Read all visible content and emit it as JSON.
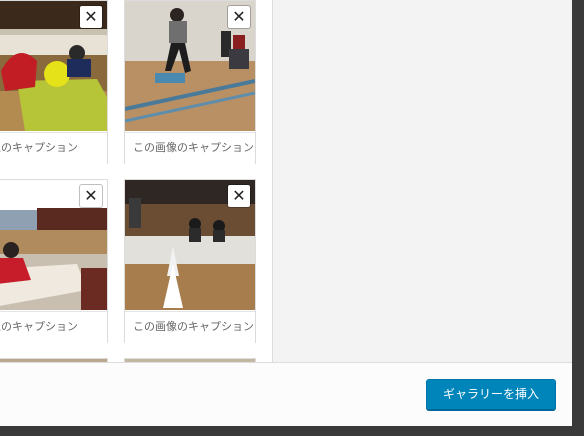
{
  "gallery": {
    "items": [
      {
        "caption": "この画像のキャプション",
        "remove_glyph": "✕"
      },
      {
        "caption": "この画像のキャプション",
        "remove_glyph": "✕"
      },
      {
        "caption": "この画像のキャプション",
        "remove_glyph": "✕"
      },
      {
        "caption": "この画像のキャプション",
        "remove_glyph": "✕"
      }
    ]
  },
  "footer": {
    "insert_label": "ギャラリーを挿入"
  },
  "colors": {
    "primary_button": "#0085ba",
    "sidebar_bg": "#f3f3f3"
  }
}
